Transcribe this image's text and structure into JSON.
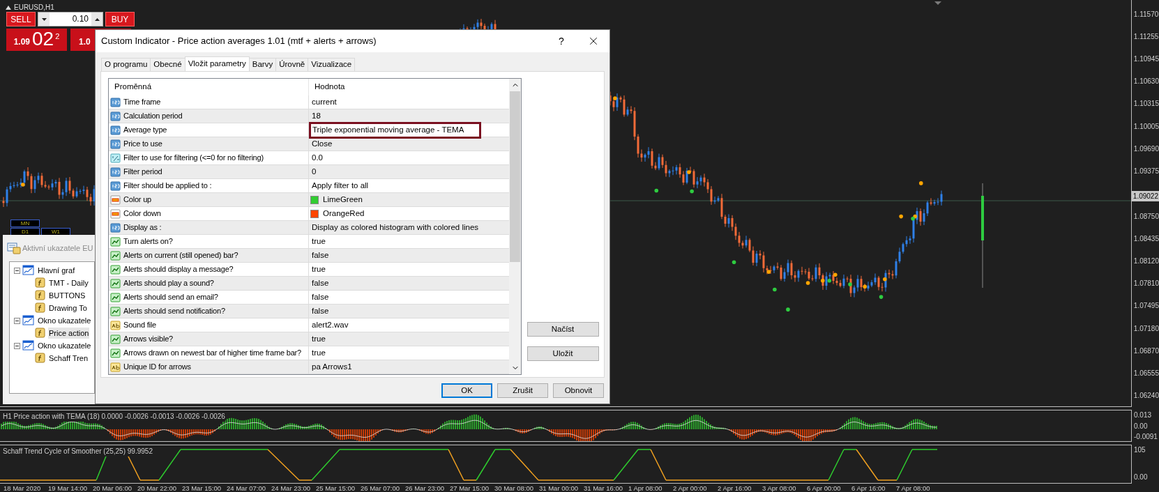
{
  "chart": {
    "symbol": "EURUSD,H1",
    "price_axis": [
      {
        "label": "1.11570",
        "kind": "tick"
      },
      {
        "label": "1.11255",
        "kind": "tick"
      },
      {
        "label": "1.10945",
        "kind": "tick"
      },
      {
        "label": "1.10630",
        "kind": "tick"
      },
      {
        "label": "1.10315",
        "kind": "tick"
      },
      {
        "label": "1.10005",
        "kind": "tick"
      },
      {
        "label": "1.09690",
        "kind": "tick"
      },
      {
        "label": "1.09375",
        "kind": "tick"
      },
      {
        "label": "1.09022",
        "kind": "current"
      },
      {
        "label": "1.08750",
        "kind": "tick"
      },
      {
        "label": "1.08435",
        "kind": "tick"
      },
      {
        "label": "1.08120",
        "kind": "tick"
      },
      {
        "label": "1.07810",
        "kind": "tick"
      },
      {
        "label": "1.07495",
        "kind": "tick"
      },
      {
        "label": "1.07180",
        "kind": "tick"
      },
      {
        "label": "1.06870",
        "kind": "tick"
      },
      {
        "label": "1.06555",
        "kind": "tick"
      },
      {
        "label": "1.06240",
        "kind": "tick"
      }
    ],
    "time_axis": [
      "18 Mar 2020",
      "19 Mar 14:00",
      "20 Mar 06:00",
      "20 Mar 22:00",
      "23 Mar 15:00",
      "24 Mar 07:00",
      "24 Mar 23:00",
      "25 Mar 15:00",
      "26 Mar 07:00",
      "26 Mar 23:00",
      "27 Mar 15:00",
      "30 Mar 08:00",
      "31 Mar 00:00",
      "31 Mar 16:00",
      "1 Apr 08:00",
      "2 Apr 00:00",
      "2 Apr 16:00",
      "3 Apr 08:00",
      "6 Apr 00:00",
      "6 Apr 16:00",
      "7 Apr 08:00"
    ],
    "timeframes": [
      "MN",
      "D1",
      "W1"
    ]
  },
  "trade_panel": {
    "sell": "SELL",
    "buy": "BUY",
    "lot": "0.10",
    "bid_prefix": "1.09",
    "bid_main": "02",
    "bid_sup": "2",
    "ask_prefix": "1.0"
  },
  "subwindows": [
    {
      "title": "H1 Price action with TEMA (18) 0.0000 -0.0026 -0.0013 -0.0026 -0.0026",
      "axis": [
        "0.013",
        "0.00",
        "-0.0091"
      ]
    },
    {
      "title": "Schaff Trend Cycle of Smoother (25,25) 99.9952",
      "axis": [
        "105",
        "0.00"
      ]
    }
  ],
  "indicators_window": {
    "title": "Aktivní ukazatele EU",
    "tree": [
      {
        "label": "Hlavní graf",
        "expanded": true,
        "selected": false,
        "children": [
          {
            "label": "TMT - Daily",
            "selected": false
          },
          {
            "label": "BUTTONS",
            "selected": false
          },
          {
            "label": "Drawing To",
            "selected": false
          }
        ]
      },
      {
        "label": "Okno ukazatele",
        "expanded": true,
        "selected": false,
        "children": [
          {
            "label": "Price action",
            "selected": true
          }
        ]
      },
      {
        "label": "Okno ukazatele",
        "expanded": true,
        "selected": false,
        "children": [
          {
            "label": "Schaff Tren",
            "selected": false
          }
        ]
      }
    ]
  },
  "dialog": {
    "title": "Custom Indicator - Price action averages 1.01 (mtf + alerts + arrows)",
    "help": "?",
    "tabs": [
      {
        "label": "O programu",
        "selected": false
      },
      {
        "label": "Obecné",
        "selected": false
      },
      {
        "label": "Vložit parametry",
        "selected": true
      },
      {
        "label": "Barvy",
        "selected": false
      },
      {
        "label": "Úrovně",
        "selected": false
      },
      {
        "label": "Vizualizace",
        "selected": false
      }
    ],
    "columns": [
      "Proměnná",
      "Hodnota"
    ],
    "rows": [
      {
        "kind": "int",
        "name": "Time frame",
        "value": "current",
        "highlighted": false
      },
      {
        "kind": "int",
        "name": "Calculation period",
        "value": "18",
        "highlighted": false
      },
      {
        "kind": "int",
        "name": "Average type",
        "value": "Triple exponential moving average - TEMA",
        "highlighted": true
      },
      {
        "kind": "int",
        "name": "Price to use",
        "value": "Close",
        "highlighted": false
      },
      {
        "kind": "double",
        "name": "Filter to use for filtering (<=0 for no filtering)",
        "value": "0.0",
        "highlighted": false
      },
      {
        "kind": "int",
        "name": "Filter period",
        "value": "0",
        "highlighted": false
      },
      {
        "kind": "int",
        "name": "Filter should be applied to :",
        "value": "Apply filter to all",
        "highlighted": false
      },
      {
        "kind": "color",
        "name": "Color up",
        "value": "LimeGreen",
        "color": "#32cd32",
        "highlighted": false
      },
      {
        "kind": "color",
        "name": "Color down",
        "value": "OrangeRed",
        "color": "#ff4500",
        "highlighted": false
      },
      {
        "kind": "int",
        "name": "Display as :",
        "value": "Display as colored histogram with colored lines",
        "highlighted": false
      },
      {
        "kind": "bool",
        "name": "Turn alerts on?",
        "value": "true",
        "highlighted": false
      },
      {
        "kind": "bool",
        "name": "Alerts on current (still opened) bar?",
        "value": "false",
        "highlighted": false
      },
      {
        "kind": "bool",
        "name": "Alerts should display a message?",
        "value": "true",
        "highlighted": false
      },
      {
        "kind": "bool",
        "name": "Alerts should play a sound?",
        "value": "false",
        "highlighted": false
      },
      {
        "kind": "bool",
        "name": "Alerts should send an email?",
        "value": "false",
        "highlighted": false
      },
      {
        "kind": "bool",
        "name": "Alerts should send notification?",
        "value": "false",
        "highlighted": false
      },
      {
        "kind": "string",
        "name": "Sound file",
        "value": "alert2.wav",
        "highlighted": false
      },
      {
        "kind": "bool",
        "name": "Arrows visible?",
        "value": "true",
        "highlighted": false
      },
      {
        "kind": "bool",
        "name": "Arrows drawn on newest bar of higher time frame bar?",
        "value": "true",
        "highlighted": false
      },
      {
        "kind": "string",
        "name": "Unique ID for arrows",
        "value": "pa Arrows1",
        "highlighted": false
      }
    ],
    "side_buttons": [
      "Načíst",
      "Uložit"
    ],
    "buttons": [
      {
        "label": "OK",
        "default": true
      },
      {
        "label": "Zrušit",
        "default": false
      },
      {
        "label": "Obnovit",
        "default": false
      }
    ]
  }
}
